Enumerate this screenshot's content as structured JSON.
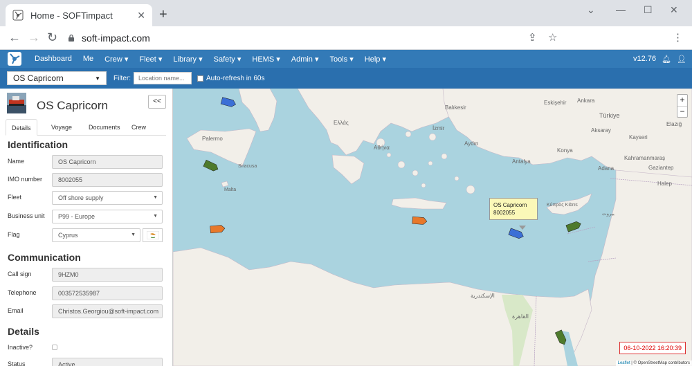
{
  "browser": {
    "tab_title": "Home - SOFTimpact",
    "url": "soft-impact.com"
  },
  "navbar": {
    "items": [
      "Dashboard",
      "Me",
      "Crew ▾",
      "Fleet ▾",
      "Library ▾",
      "Safety ▾",
      "HEMS ▾",
      "Admin ▾",
      "Tools ▾",
      "Help ▾"
    ],
    "version": "v12.76"
  },
  "filterbar": {
    "vessel": "OS Capricorn",
    "filter_label": "Filter:",
    "filter_placeholder": "Location name...",
    "autorefresh": "Auto-refresh in 60s"
  },
  "panel": {
    "vessel_name": "OS Capricorn",
    "collapse": "<<",
    "tabs": [
      "Details",
      "Voyage",
      "Documents",
      "Crew"
    ],
    "identification": {
      "heading": "Identification",
      "name_label": "Name",
      "name": "OS Capricorn",
      "imo_label": "IMO number",
      "imo": "8002055",
      "fleet_label": "Fleet",
      "fleet": "Off shore supply",
      "bu_label": "Business unit",
      "bu": "P99 - Europe",
      "flag_label": "Flag",
      "flag": "Cyprus"
    },
    "communication": {
      "heading": "Communication",
      "callsign_label": "Call sign",
      "callsign": "9HZM0",
      "phone_label": "Telephone",
      "phone": "003572535987",
      "email_label": "Email",
      "email": "Christos.Georgiou@soft-impact.com"
    },
    "details": {
      "heading": "Details",
      "inactive_label": "Inactive?",
      "status_label": "Status",
      "status": "Active"
    }
  },
  "map": {
    "popup_name": "OS Capricorn",
    "popup_imo": "8002055",
    "clock": "06-10-2022 16:20:39",
    "attribution_leaflet": "Leaflet",
    "attribution_osm": "© OpenStreetMap contributors",
    "zoom_in": "+",
    "zoom_out": "−",
    "labels": {
      "sea_lanes": "",
      "balikesir": "Balıkesir",
      "turkiye": "Türkiye",
      "eskisehir": "Eskişehir",
      "ankara": "Ankara",
      "aksaray": "Aksaray",
      "kayseri": "Kayseri",
      "elazig": "Elazığ",
      "izmir": "İzmir",
      "aydin": "Aydın",
      "konya": "Konya",
      "antalya": "Antalya",
      "kahramanmaras": "Kahramanmaraş",
      "adana": "Adana",
      "gaziantep": "Gaziantep",
      "halep": "Halep",
      "ellas": "Ελλάς",
      "athens": "Αθήνα",
      "palermo": "Palermo",
      "siracusa": "Siracusa",
      "malta": "Malta",
      "kibris": "Κύπρος Kıbrıs",
      "beirut": "بيروت",
      "cairo": "القاهرة",
      "iskandariya": "الإسكندرية"
    },
    "vessels": [
      {
        "color": "#3b6fd6"
      },
      {
        "color": "#4e7a2c"
      },
      {
        "color": "#e8782a"
      },
      {
        "color": "#e8782a"
      },
      {
        "color": "#3b6fd6"
      },
      {
        "color": "#4e7a2c"
      },
      {
        "color": "#4e7a2c"
      }
    ]
  }
}
